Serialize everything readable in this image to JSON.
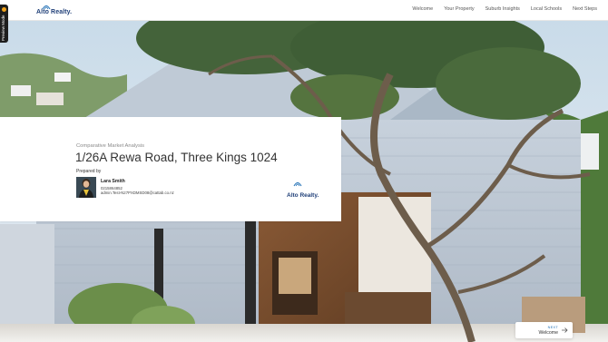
{
  "header": {
    "logo_text": "Alto Realty.",
    "nav": [
      "Welcome",
      "Your Property",
      "Suburb Insights",
      "Local Schools",
      "Next Steps"
    ]
  },
  "preview_tab": {
    "label": "Preview Mode"
  },
  "card": {
    "subtitle": "Comparative Market Analysis",
    "address": "1/26A Rewa Road, Three Kings  1024",
    "prepared_by": "Prepared by",
    "agent": {
      "name": "Lara Smith",
      "phone": "0215864852",
      "email": "admin.Test-N27PXDMSD08@cattab.co.nz"
    },
    "logo_text": "Alto Realty."
  },
  "next": {
    "kicker": "NEXT",
    "label": "Welcome"
  },
  "colors": {
    "brand": "#1f3f78",
    "accent": "#f0a21b",
    "link": "#1f6fb5"
  },
  "icons": [
    "logo-mark-icon",
    "arrow-right-icon"
  ]
}
